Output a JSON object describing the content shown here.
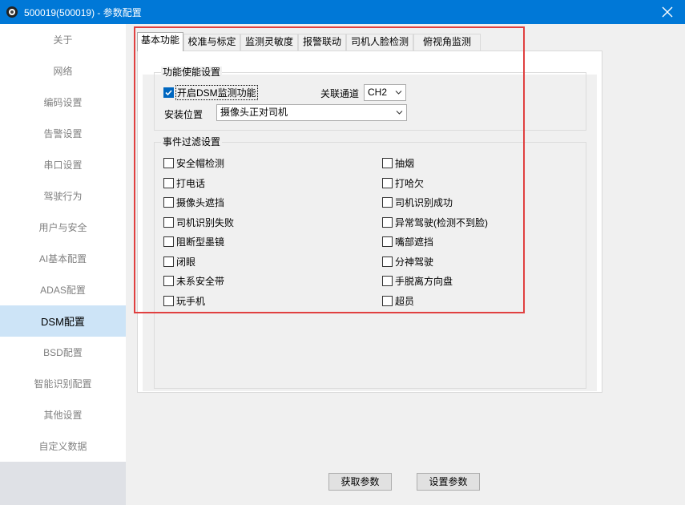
{
  "window": {
    "title": "500019(500019) - 参数配置"
  },
  "sidebar": {
    "items": [
      {
        "label": "关于"
      },
      {
        "label": "网络"
      },
      {
        "label": "编码设置"
      },
      {
        "label": "告警设置"
      },
      {
        "label": "串口设置"
      },
      {
        "label": "驾驶行为"
      },
      {
        "label": "用户与安全"
      },
      {
        "label": "AI基本配置"
      },
      {
        "label": "ADAS配置"
      },
      {
        "label": "DSM配置"
      },
      {
        "label": "BSD配置"
      },
      {
        "label": "智能识别配置"
      },
      {
        "label": "其他设置"
      },
      {
        "label": "自定义数据"
      }
    ],
    "active_index": 9
  },
  "tabs": [
    {
      "label": "基本功能"
    },
    {
      "label": "校准与标定"
    },
    {
      "label": "监测灵敏度"
    },
    {
      "label": "报警联动"
    },
    {
      "label": "司机人脸检测"
    },
    {
      "label": "俯视角监测"
    }
  ],
  "function_group": {
    "title": "功能使能设置",
    "enable_dsm": {
      "label": "开启DSM监测功能",
      "checked": true
    },
    "channel": {
      "label": "关联通道",
      "value": "CH2"
    },
    "position": {
      "label": "安装位置",
      "value": "摄像头正对司机"
    }
  },
  "event_group": {
    "title": "事件过滤设置",
    "left": [
      {
        "label": "安全帽检测",
        "checked": false
      },
      {
        "label": "打电话",
        "checked": false
      },
      {
        "label": "摄像头遮挡",
        "checked": false
      },
      {
        "label": "司机识别失败",
        "checked": false
      },
      {
        "label": "阻断型墨镜",
        "checked": false
      },
      {
        "label": "闭眼",
        "checked": false
      },
      {
        "label": "未系安全带",
        "checked": false
      },
      {
        "label": "玩手机",
        "checked": false
      }
    ],
    "right": [
      {
        "label": "抽烟",
        "checked": false
      },
      {
        "label": "打哈欠",
        "checked": false
      },
      {
        "label": "司机识别成功",
        "checked": false
      },
      {
        "label": "异常驾驶(检测不到脸)",
        "checked": false
      },
      {
        "label": "嘴部遮挡",
        "checked": false
      },
      {
        "label": "分神驾驶",
        "checked": false
      },
      {
        "label": "手脱离方向盘",
        "checked": false
      },
      {
        "label": "超员",
        "checked": false
      }
    ]
  },
  "buttons": {
    "get": "获取参数",
    "set": "设置参数"
  },
  "colors": {
    "titlebar": "#0078d7",
    "active_sidebar": "#cde4f7",
    "checkbox_checked": "#0067c0",
    "highlight_box": "#e04040"
  }
}
